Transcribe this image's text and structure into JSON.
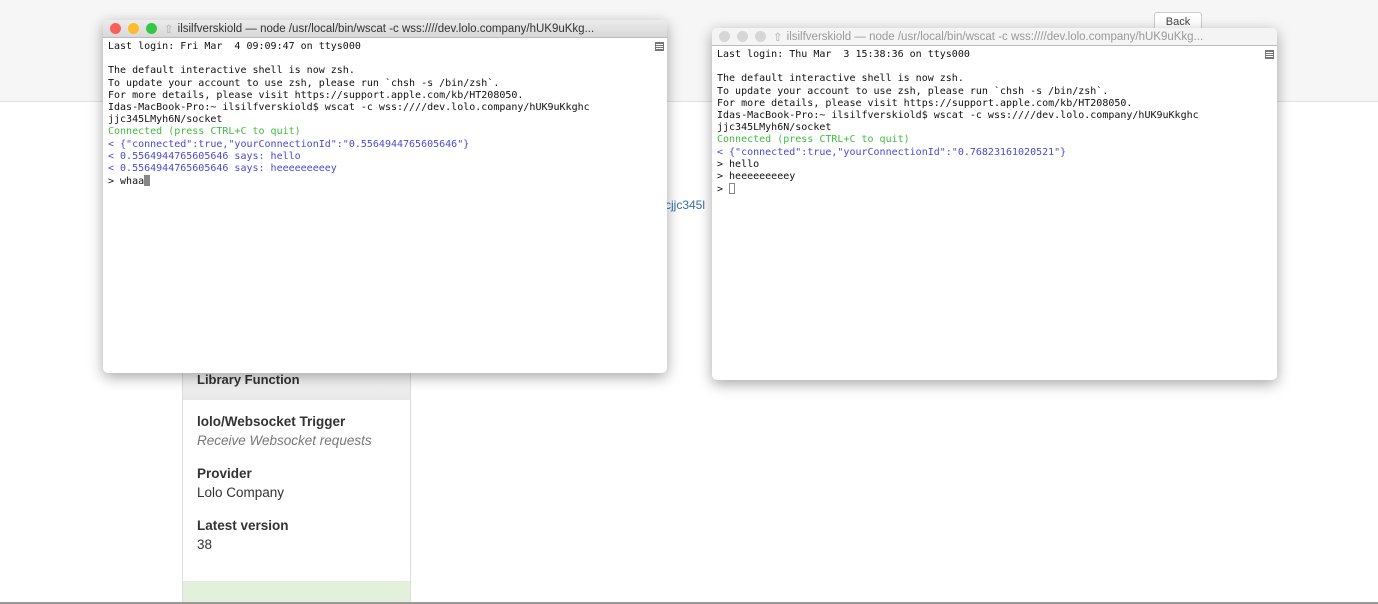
{
  "page": {
    "back_label": "Back",
    "link_fragment": "cjjc345l",
    "card": {
      "header": "Library Function",
      "title": "lolo/Websocket Trigger",
      "subtitle": "Receive Websocket requests",
      "provider_label": "Provider",
      "provider": "Lolo Company",
      "version_label": "Latest version",
      "version": "38"
    }
  },
  "terminal_left": {
    "title": "ilsilfverskiold — node /usr/local/bin/wscat -c wss:////dev.lolo.company/hUK9uKkg...",
    "lines": [
      "Last login: Fri Mar  4 09:09:47 on ttys000",
      "",
      "The default interactive shell is now zsh.",
      "To update your account to use zsh, please run `chsh -s /bin/zsh`.",
      "For more details, please visit https://support.apple.com/kb/HT208050.",
      "Idas-MacBook-Pro:~ ilsilfverskiold$ wscat -c wss:////dev.lolo.company/hUK9uKkghc",
      "jjc345LMyh6N/socket"
    ],
    "connected": "Connected (press CTRL+C to quit)",
    "messages": [
      "< {\"connected\":true,\"yourConnectionId\":\"0.5564944765605646\"}",
      "< 0.5564944765605646 says: hello",
      "< 0.5564944765605646 says: heeeeeeeeey"
    ],
    "input": "> whaa"
  },
  "terminal_right": {
    "title": "ilsilfverskiold — node /usr/local/bin/wscat -c wss:////dev.lolo.company/hUK9uKkg...",
    "lines": [
      "Last login: Thu Mar  3 15:38:36 on ttys000",
      "",
      "The default interactive shell is now zsh.",
      "To update your account to use zsh, please run `chsh -s /bin/zsh`.",
      "For more details, please visit https://support.apple.com/kb/HT208050.",
      "Idas-MacBook-Pro:~ ilsilfverskiold$ wscat -c wss:////dev.lolo.company/hUK9uKkghc",
      "jjc345LMyh6N/socket"
    ],
    "connected": "Connected (press CTRL+C to quit)",
    "messages": [
      "< {\"connected\":true,\"yourConnectionId\":\"0.76823161020521\"}"
    ],
    "sent": [
      "> hello",
      "> heeeeeeeeey"
    ],
    "input": "> "
  },
  "colors": {
    "connected": "#3ebd3e",
    "message": "#4a4ad0",
    "close": "#fc5f57",
    "minimize": "#fdbc2e",
    "zoom": "#33c748"
  }
}
